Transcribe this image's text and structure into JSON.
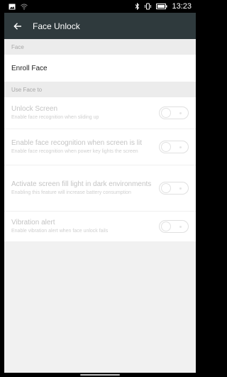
{
  "statusbar": {
    "time": "13:23"
  },
  "appbar": {
    "title": "Face Unlock"
  },
  "section_face": {
    "label": "Face"
  },
  "enroll": {
    "label": "Enroll Face"
  },
  "section_use": {
    "label": "Use Face to"
  },
  "settings": [
    {
      "title": "Unlock Screen",
      "desc": "Enable face recognition when sliding up",
      "enabled": false
    },
    {
      "title": "Enable face recognition when screen is lit",
      "desc": "Enable face recognition when power key lights the screen",
      "enabled": false
    },
    {
      "title": "Activate screen fill light in dark environments",
      "desc": "Enabling this feature will increase battery consumption",
      "enabled": false
    },
    {
      "title": "Vibration alert",
      "desc": "Enable vibration alert when face unlock fails",
      "enabled": false
    }
  ]
}
